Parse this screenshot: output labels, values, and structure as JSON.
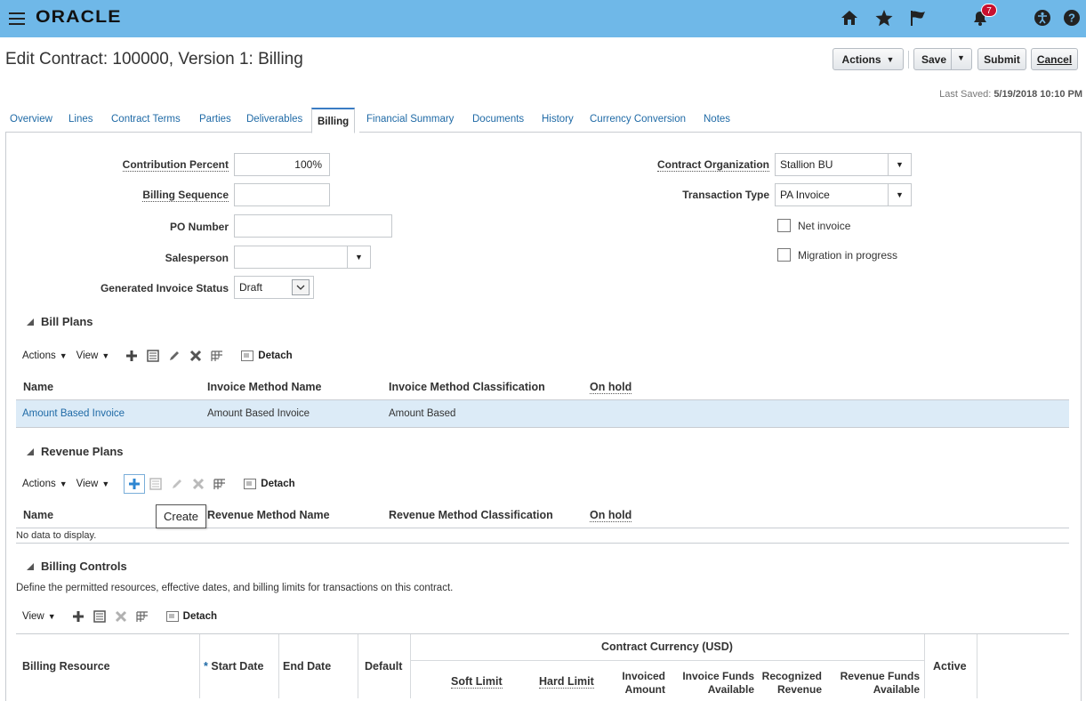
{
  "topbar": {
    "logo": "ORACLE",
    "notification_count": "7"
  },
  "header": {
    "title": "Edit Contract: 100000, Version 1: Billing",
    "actions_label": "Actions",
    "save_label": "Save",
    "submit_label": "Submit",
    "cancel_label": "Cancel",
    "last_saved_label": "Last Saved:",
    "last_saved_value": "5/19/2018 10:10 PM"
  },
  "tabs": [
    "Overview",
    "Lines",
    "Contract Terms",
    "Parties",
    "Deliverables",
    "Billing",
    "Financial Summary",
    "Documents",
    "History",
    "Currency Conversion",
    "Notes"
  ],
  "form": {
    "contribution_percent_label": "Contribution Percent",
    "contribution_percent_value": "100%",
    "billing_sequence_label": "Billing Sequence",
    "billing_sequence_value": "",
    "po_number_label": "PO Number",
    "po_number_value": "",
    "salesperson_label": "Salesperson",
    "salesperson_value": "",
    "generated_invoice_status_label": "Generated Invoice Status",
    "generated_invoice_status_value": "Draft",
    "contract_organization_label": "Contract Organization",
    "contract_organization_value": "Stallion BU",
    "transaction_type_label": "Transaction Type",
    "transaction_type_value": "PA Invoice",
    "net_invoice_label": "Net invoice",
    "migration_label": "Migration in progress"
  },
  "bill_plans": {
    "title": "Bill Plans",
    "actions_label": "Actions",
    "view_label": "View",
    "detach_label": "Detach",
    "columns": [
      "Name",
      "Invoice Method Name",
      "Invoice Method Classification",
      "On hold"
    ],
    "rows": [
      [
        "Amount Based Invoice",
        "Amount Based Invoice",
        "Amount Based",
        ""
      ]
    ]
  },
  "revenue_plans": {
    "title": "Revenue Plans",
    "actions_label": "Actions",
    "view_label": "View",
    "detach_label": "Detach",
    "columns": [
      "Name",
      "Revenue Method Name",
      "Revenue Method Classification",
      "On hold"
    ],
    "empty_text": "No data to display.",
    "tooltip": "Create"
  },
  "billing_controls": {
    "title": "Billing Controls",
    "description": "Define the permitted resources, effective dates, and billing limits for transactions on this contract.",
    "view_label": "View",
    "detach_label": "Detach",
    "currency_group": "Contract Currency (USD)",
    "columns": {
      "resource": "Billing Resource",
      "start_date": "Start Date",
      "end_date": "End Date",
      "default": "Default",
      "soft_limit": "Soft Limit",
      "hard_limit": "Hard Limit",
      "invoiced_amount_1": "Invoiced",
      "invoiced_amount_2": "Amount",
      "invoice_funds_1": "Invoice Funds",
      "invoice_funds_2": "Available",
      "recognized_revenue_1": "Recognized",
      "recognized_revenue_2": "Revenue",
      "revenue_funds_1": "Revenue Funds",
      "revenue_funds_2": "Available",
      "active": "Active"
    }
  }
}
